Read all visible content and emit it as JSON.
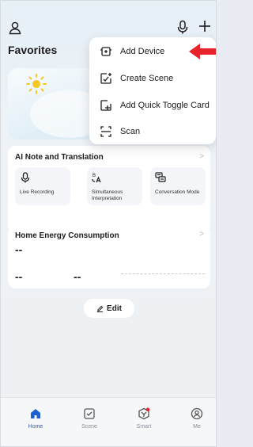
{
  "header": {
    "title": "Favorites"
  },
  "menu": {
    "items": [
      {
        "label": "Add Device",
        "icon": "add-device-icon"
      },
      {
        "label": "Create Scene",
        "icon": "create-scene-icon"
      },
      {
        "label": "Add Quick Toggle Card",
        "icon": "quick-toggle-icon"
      },
      {
        "label": "Scan",
        "icon": "scan-icon"
      }
    ]
  },
  "ai_card": {
    "title": "AI Note and Translation",
    "chevron": ">",
    "tiles": [
      {
        "label": "Live Recording",
        "icon": "microphone-icon"
      },
      {
        "label": "Simultaneous Interpretation",
        "icon": "translate-icon"
      },
      {
        "label": "Conversation Mode",
        "icon": "conversation-icon"
      }
    ]
  },
  "energy_card": {
    "title": "Home Energy Consumption",
    "chevron": ">",
    "main_value": "--",
    "value_left": "--",
    "value_right": "--"
  },
  "edit": {
    "label": "Edit"
  },
  "nav": {
    "items": [
      {
        "label": "Home",
        "icon": "home-icon",
        "active": true
      },
      {
        "label": "Scene",
        "icon": "scene-icon",
        "active": false
      },
      {
        "label": "Smart",
        "icon": "smart-icon",
        "active": false
      },
      {
        "label": "Me",
        "icon": "me-icon",
        "active": false
      }
    ]
  },
  "colors": {
    "accent": "#1f5fd6",
    "arrow": "#e8222a",
    "notification_dot": "#e8222a"
  }
}
